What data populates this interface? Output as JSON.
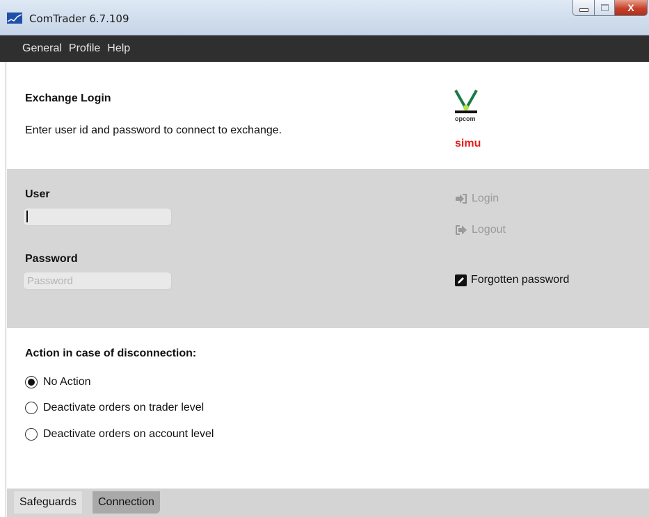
{
  "window": {
    "title": "ComTrader 6.7.109",
    "close_glyph": "X"
  },
  "menu": {
    "items": [
      "General",
      "Profile",
      "Help"
    ]
  },
  "header": {
    "title": "Exchange Login",
    "description": "Enter user id and password to connect to exchange.",
    "logo_text": "opcom",
    "environment": "simu",
    "environment_color": "#e41b1b"
  },
  "login": {
    "user_label": "User",
    "user_value": "",
    "password_label": "Password",
    "password_placeholder": "Password",
    "login_label": "Login",
    "logout_label": "Logout",
    "forgot_label": "Forgotten password",
    "icons": {
      "login": "sign-in-icon",
      "logout": "sign-out-icon",
      "forgot": "edit-icon"
    }
  },
  "safeguards": {
    "title": "Action in case of disconnection:",
    "options": [
      {
        "label": "No Action",
        "selected": true
      },
      {
        "label": "Deactivate orders on trader level",
        "selected": false
      },
      {
        "label": "Deactivate orders on account level",
        "selected": false
      }
    ]
  },
  "tabs": [
    {
      "label": "Safeguards",
      "active": false
    },
    {
      "label": "Connection",
      "active": true
    }
  ]
}
